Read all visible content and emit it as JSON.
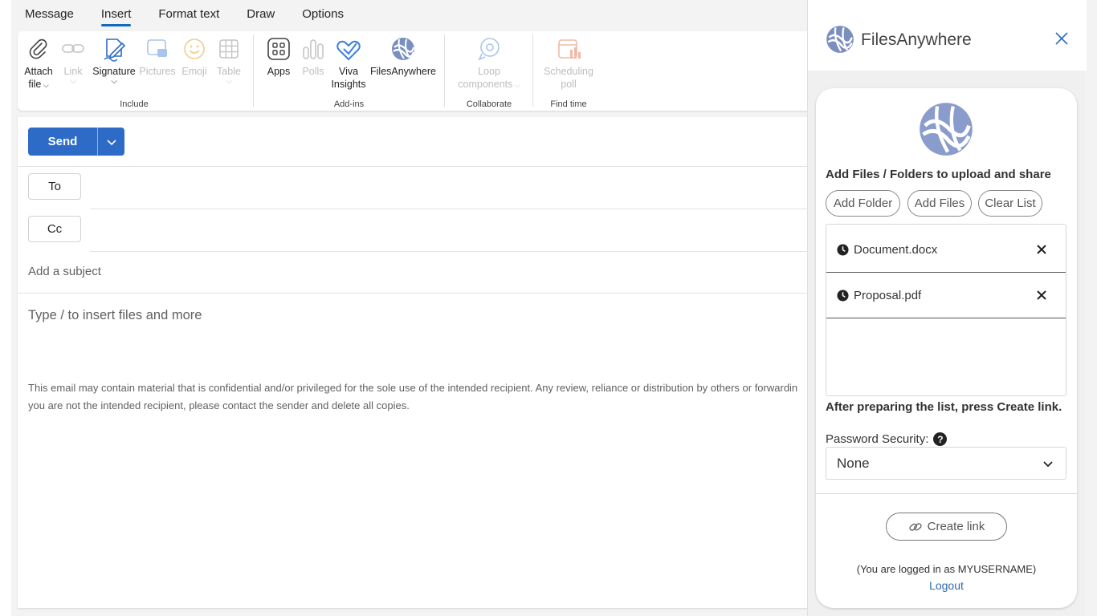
{
  "tabs": [
    {
      "label": "Message"
    },
    {
      "label": "Insert"
    },
    {
      "label": "Format text"
    },
    {
      "label": "Draw"
    },
    {
      "label": "Options"
    }
  ],
  "ribbon": {
    "groups": {
      "include": "Include",
      "addins": "Add-ins",
      "collaborate": "Collaborate",
      "findtime": "Find time"
    },
    "attach": {
      "line1": "Attach",
      "line2": "file"
    },
    "link": "Link",
    "signature": "Signature",
    "pictures": "Pictures",
    "emoji": "Emoji",
    "table": "Table",
    "apps": "Apps",
    "polls": "Polls",
    "viva": {
      "line1": "Viva",
      "line2": "Insights"
    },
    "filesanywhere": "FilesAnywhere",
    "loop": {
      "line1": "Loop",
      "line2": "components"
    },
    "scheduling": {
      "line1": "Scheduling",
      "line2": "poll"
    }
  },
  "compose": {
    "send_label": "Send",
    "to_label": "To",
    "cc_label": "Cc",
    "subject_placeholder": "Add a subject",
    "body_placeholder": "Type / to insert files and more",
    "disclaimer_line1": "This email may contain material that is confidential and/or privileged for the sole use of the intended recipient. Any review, reliance or distribution by others or forwardin",
    "disclaimer_line2": "you are not the intended recipient, please contact the sender and delete all copies."
  },
  "panel": {
    "title": "FilesAnywhere",
    "heading": "Add Files / Folders to upload and share",
    "add_folder": "Add Folder",
    "add_files": "Add Files",
    "clear_list": "Clear List",
    "files": [
      {
        "name": "Document.docx"
      },
      {
        "name": "Proposal.pdf"
      }
    ],
    "after_text": "After preparing the list, press Create link.",
    "password_label": "Password Security:",
    "help_glyph": "?",
    "password_value": "None",
    "create_link": "Create link",
    "logged_in": "(You are logged in as MYUSERNAME)",
    "logout": "Logout"
  },
  "colors": {
    "accent": "#0f6cbd",
    "send": "#2e6bc6",
    "link": "#2b6cb0"
  }
}
